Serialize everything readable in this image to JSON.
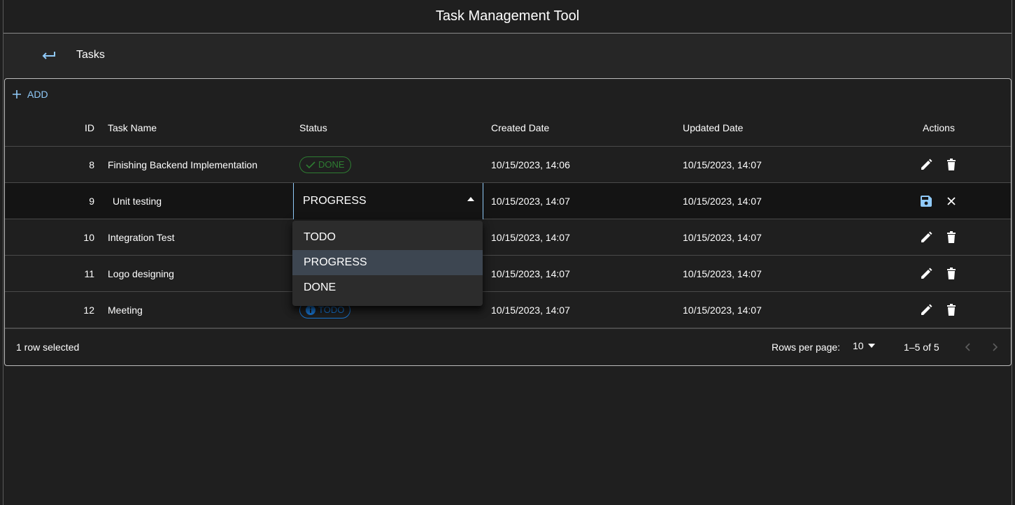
{
  "app": {
    "title": "Task Management Tool"
  },
  "subheader": {
    "title": "Tasks",
    "back_icon": "back-arrow-icon"
  },
  "toolbar": {
    "add_label": "ADD"
  },
  "table": {
    "columns": {
      "id": "ID",
      "name": "Task Name",
      "status": "Status",
      "created": "Created Date",
      "updated": "Updated Date",
      "actions": "Actions"
    },
    "rows": [
      {
        "id": "8",
        "name": "Finishing Backend Implementation",
        "status": "DONE",
        "created": "10/15/2023, 14:06",
        "updated": "10/15/2023, 14:07"
      },
      {
        "id": "9",
        "name": "Unit testing",
        "status": "PROGRESS",
        "created": "10/15/2023, 14:07",
        "updated": "10/15/2023, 14:07"
      },
      {
        "id": "10",
        "name": "Integration Test",
        "status": "",
        "created": "10/15/2023, 14:07",
        "updated": "10/15/2023, 14:07"
      },
      {
        "id": "11",
        "name": "Logo designing",
        "status": "",
        "created": "10/15/2023, 14:07",
        "updated": "10/15/2023, 14:07"
      },
      {
        "id": "12",
        "name": "Meeting",
        "status": "TODO",
        "created": "10/15/2023, 14:07",
        "updated": "10/15/2023, 14:07"
      }
    ]
  },
  "status_menu": {
    "options": [
      "TODO",
      "PROGRESS",
      "DONE"
    ],
    "selected": "PROGRESS"
  },
  "footer": {
    "selected_text": "1 row selected",
    "rows_per_page_label": "Rows per page:",
    "rows_per_page_value": "10",
    "range_text": "1–5 of 5"
  },
  "colors": {
    "accent": "#90caf9",
    "done": "#2e7d32",
    "todo": "#1976d2",
    "background": "#1f1f1f"
  }
}
